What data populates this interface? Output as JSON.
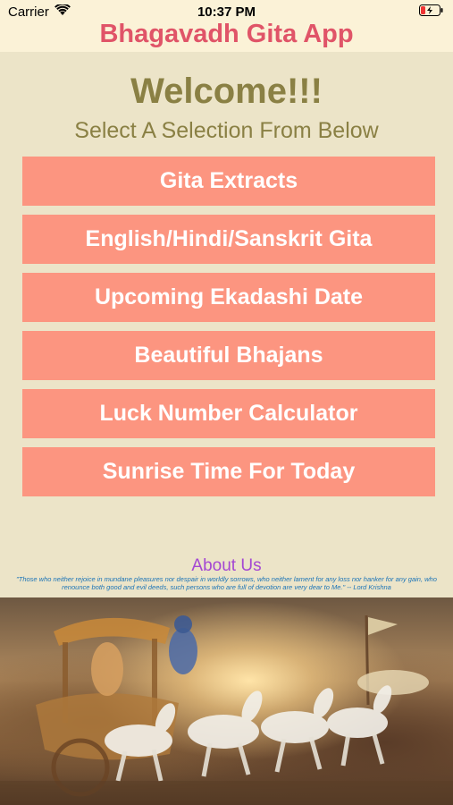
{
  "status_bar": {
    "carrier": "Carrier",
    "time": "10:37 PM"
  },
  "header": {
    "title": "Bhagavadh Gita App"
  },
  "main": {
    "welcome": "Welcome!!!",
    "subtitle": "Select A Selection From Below",
    "buttons": [
      {
        "label": "Gita Extracts"
      },
      {
        "label": "English/Hindi/Sanskrit Gita"
      },
      {
        "label": "Upcoming Ekadashi Date"
      },
      {
        "label": "Beautiful Bhajans"
      },
      {
        "label": "Luck Number Calculator"
      },
      {
        "label": "Sunrise Time For Today"
      }
    ]
  },
  "footer": {
    "about_us": "About Us",
    "quote": "\"Those who neither rejoice in mundane pleasures nor despair in worldly sorrows, who neither lament for any loss nor hanker for any gain, who renounce both good and evil deeds, such persons who are full of devotion are very dear to Me.\" -- Lord Krishna"
  },
  "colors": {
    "background": "#ece4c8",
    "header_bg": "#fbf2d7",
    "title": "#e05468",
    "welcome_text": "#8a8044",
    "button_bg": "#fc9580",
    "about_us": "#a447d3",
    "quote": "#1a73b7"
  },
  "icons": [
    "wifi-icon",
    "battery-icon"
  ]
}
